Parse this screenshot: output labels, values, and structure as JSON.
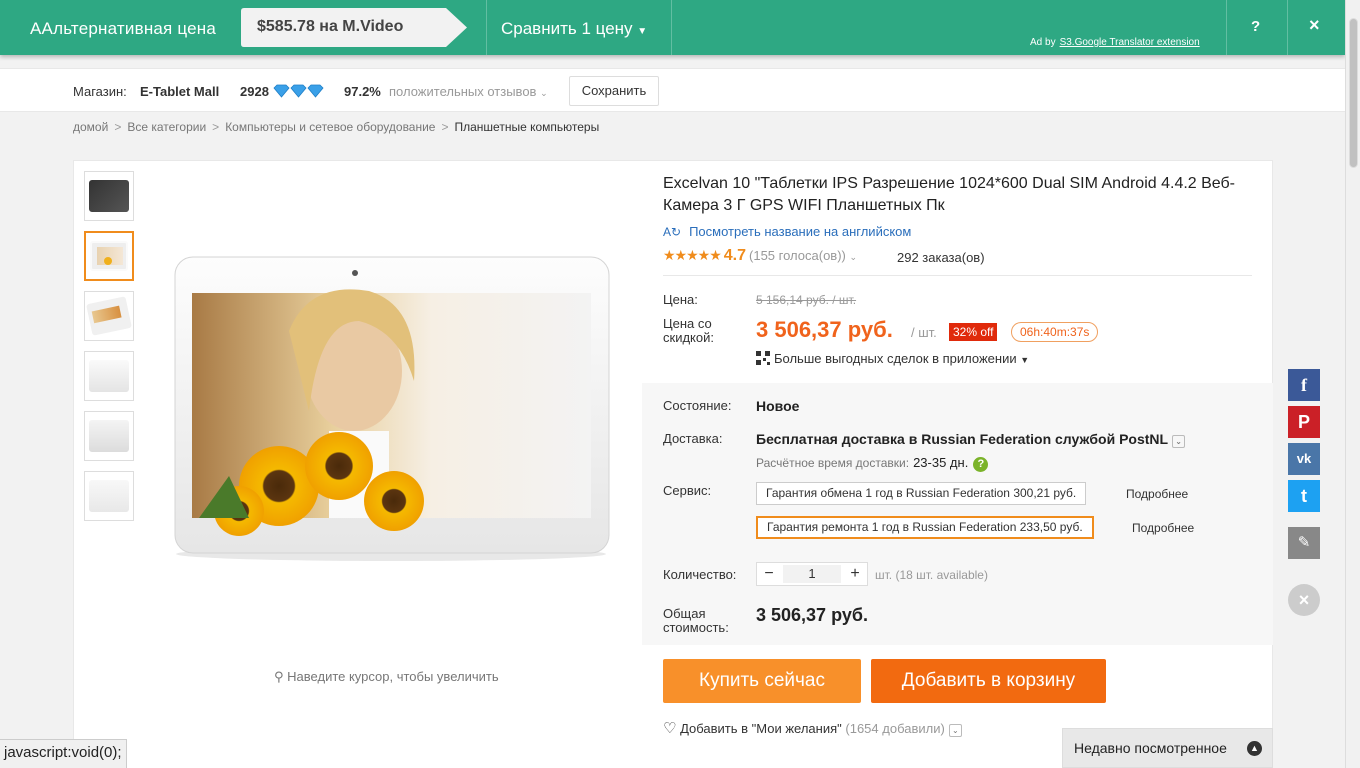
{
  "adbar": {
    "brand": "AАльтернативная цена",
    "price_offer": "$585.78 на M.Video",
    "compare": "Сравнить 1 цену",
    "ad_by": "Ad by",
    "ad_link": "S3.Google Translator extension",
    "help": "?",
    "close": "×"
  },
  "store": {
    "label": "Магазин:",
    "name": "E-Tablet Mall",
    "score": "2928",
    "positive": "97.2%",
    "positive_label": "положительных отзывов",
    "save": "Сохранить"
  },
  "breadcrumb": [
    "домой",
    "Все категории",
    "Компьютеры и сетевое оборудование",
    "Планшетные компьютеры"
  ],
  "gallery": {
    "zoom_hint": "Наведите курсор, чтобы увеличить"
  },
  "product": {
    "title": "Excelvan 10 \"Таблетки IPS Разрешение 1024*600 Dual SIM Android 4.4.2 Веб-Камера 3 Г GPS WIFI Планшетных Пк",
    "translate_link": "Посмотреть название на английском",
    "rating": "4.7",
    "votes": "(155 голоса(ов))",
    "orders": "292 заказа(ов)",
    "price_label": "Цена:",
    "old_price": "5 156,14 руб. / шт.",
    "discount_label": "Цена со скидкой:",
    "new_price": "3 506,37 руб.",
    "per_unit": "/ шт.",
    "discount": "32% off",
    "timer": "06h:40m:37s",
    "app_deals": "Больше выгодных сделок в приложении",
    "condition_label": "Состояние:",
    "condition": "Новое",
    "shipping_label": "Доставка:",
    "shipping": "Бесплатная доставка в Russian Federation службой PostNL",
    "eta_label": "Расчётное время доставки:",
    "eta": "23-35 дн.",
    "service_label": "Сервис:",
    "service_1": "Гарантия обмена 1 год в Russian Federation 300,21 руб.",
    "service_2": "Гарантия ремонта 1 год в Russian Federation 233,50 руб.",
    "more": "Подробнее",
    "quantity_label": "Количество:",
    "quantity": "1",
    "available": "шт. (18 шт. available)",
    "total_label": "Общая стоимость:",
    "total": "3 506,37 руб.",
    "buy_now": "Купить сейчас",
    "add_to_cart": "Добавить в корзину",
    "wishlist": "Добавить в \"Мои желания\"",
    "wishlist_count": "(1654 добавили)"
  },
  "recently_viewed": "Недавно посмотренное",
  "status_bar": "javascript:void(0);",
  "colors": {
    "adbar": "#2ea883",
    "accent_orange": "#f08c1c",
    "price_red": "#f0631c",
    "cart_button": "#f26a10",
    "buy_button": "#f8902a"
  }
}
